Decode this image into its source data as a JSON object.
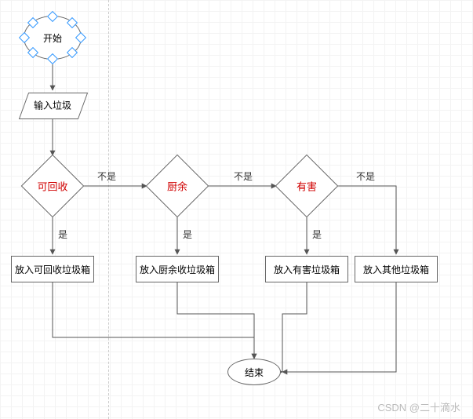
{
  "flow": {
    "start": {
      "label": "开始"
    },
    "input": {
      "label": "输入垃圾"
    },
    "d1": {
      "label": "可回收"
    },
    "d2": {
      "label": "厨余"
    },
    "d3": {
      "label": "有害"
    },
    "box1": {
      "label": "放入可回收垃圾箱"
    },
    "box2": {
      "label": "放入厨余收垃圾箱"
    },
    "box3": {
      "label": "放入有害垃圾箱"
    },
    "box4": {
      "label": "放入其他垃圾箱"
    },
    "end": {
      "label": "结束"
    },
    "edges": {
      "no1": "不是",
      "no2": "不是",
      "no3": "不是",
      "yes1": "是",
      "yes2": "是",
      "yes3": "是"
    }
  },
  "watermark": "CSDN @二十滴水"
}
